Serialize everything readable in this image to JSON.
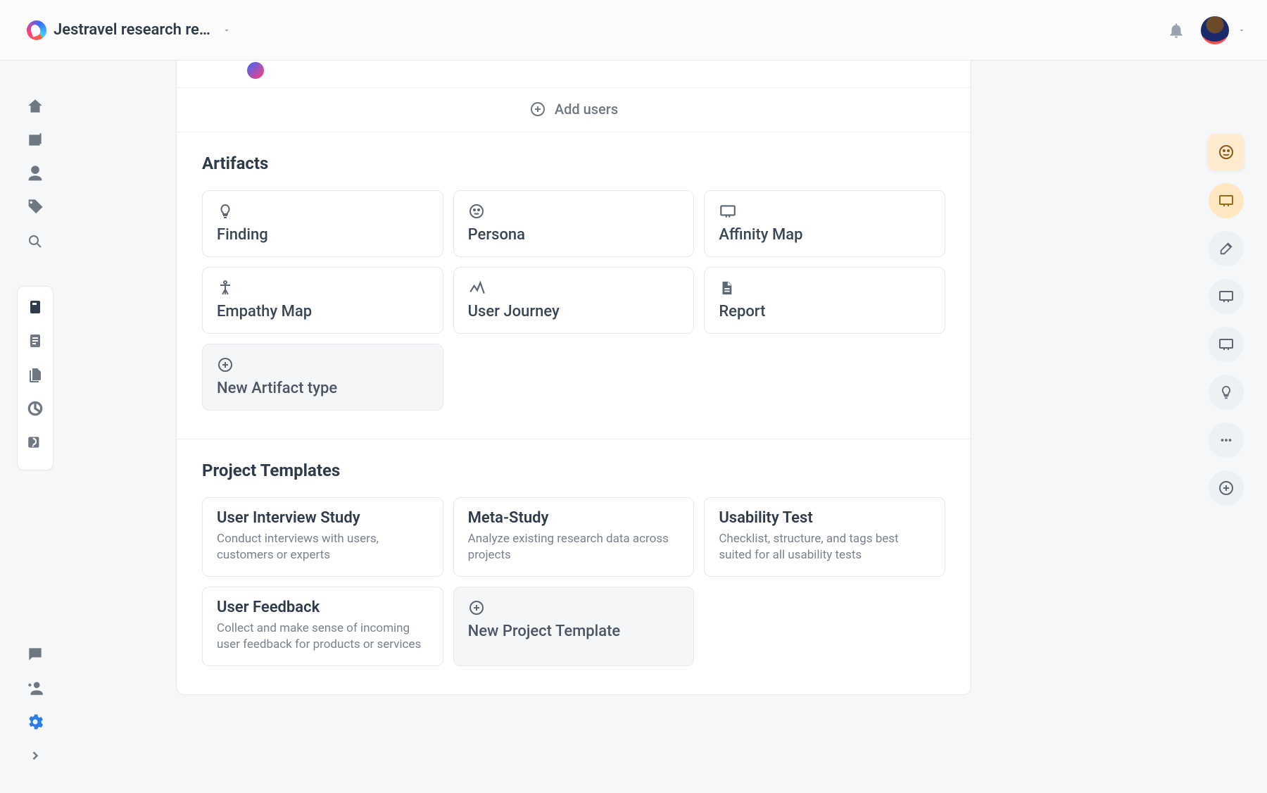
{
  "header": {
    "workspace_name": "Jestravel research re…"
  },
  "add_users_label": "Add users",
  "artifacts": {
    "heading": "Artifacts",
    "items": [
      {
        "icon": "bulb",
        "label": "Finding"
      },
      {
        "icon": "persona",
        "label": "Persona"
      },
      {
        "icon": "board",
        "label": "Affinity Map"
      },
      {
        "icon": "body",
        "label": "Empathy Map"
      },
      {
        "icon": "journey",
        "label": "User Journey"
      },
      {
        "icon": "doc",
        "label": "Report"
      }
    ],
    "new_label": "New Artifact type"
  },
  "templates": {
    "heading": "Project Templates",
    "items": [
      {
        "title": "User Interview Study",
        "desc": "Conduct interviews with users, customers or experts"
      },
      {
        "title": "Meta-Study",
        "desc": "Analyze existing research data across projects"
      },
      {
        "title": "Usability Test",
        "desc": "Checklist, structure, and tags best suited for all usability tests"
      },
      {
        "title": "User Feedback",
        "desc": "Collect and make sense of incoming user feedback for products or services"
      }
    ],
    "new_label": "New Project Template"
  }
}
